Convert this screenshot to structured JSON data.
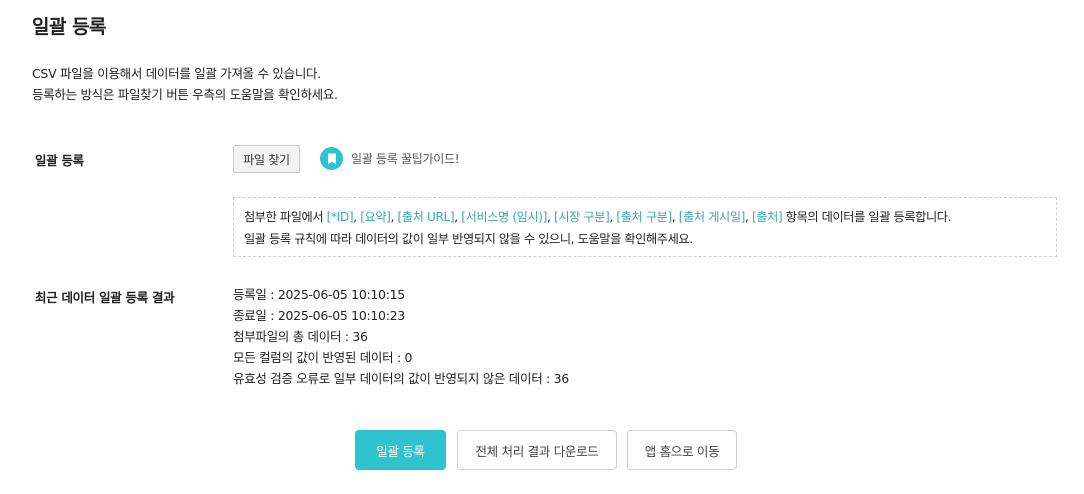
{
  "page": {
    "title": "일괄 등록",
    "intro_line1": "CSV 파일을 이용해서 데이터를 일괄 가져올 수 있습니다.",
    "intro_line2": "등록하는 방식은 파일찾기 버튼 우측의 도움말을 확인하세요."
  },
  "upload": {
    "label": "일괄 등록",
    "file_button": "파일 찾기",
    "guide_icon": "bookmark-icon",
    "guide_text": "일괄 등록 꿀팁가이드!"
  },
  "notice": {
    "prefix": "첨부한 파일에서 ",
    "fields": [
      "[*ID]",
      "[요약]",
      "[출처 URL]",
      "[서비스명 (임시)]",
      "[시장 구분]",
      "[출처 구분]",
      "[출처 게시일]",
      "[출처]"
    ],
    "suffix": " 항목의 데이터를 일괄 등록합니다.",
    "line2": "일괄 등록 규칙에 따라 데이터의 값이 일부 반영되지 않을 수 있으니, 도움말을 확인해주세요."
  },
  "results": {
    "label": "최근 데이터 일괄 등록 결과",
    "registered_at": "등록일 : 2025-06-05 10:10:15",
    "finished_at": "종료일 : 2025-06-05 10:10:23",
    "total": "첨부파일의 총 데이터 : 36",
    "all_reflected": "모든 컬럼의 값이 반영된 데이터 : 0",
    "partial": "유효성 검증 오류로 일부 데이터의 값이 반영되지 않은 데이터 : 36"
  },
  "actions": {
    "register": "일괄 등록",
    "download": "전체 처리 결과 다운로드",
    "home": "앱 홈으로 이동"
  },
  "colors": {
    "accent": "#2ec3cf",
    "field_text": "#3aa8b8"
  }
}
